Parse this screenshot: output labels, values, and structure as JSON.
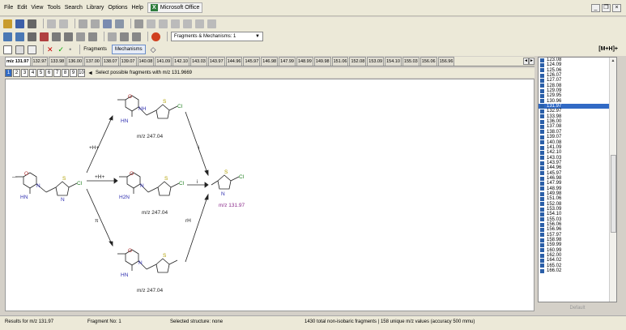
{
  "menu": {
    "items": [
      "File",
      "Edit",
      "View",
      "Tools",
      "Search",
      "Library",
      "Options",
      "Help"
    ],
    "office_label": "Microsoft Office"
  },
  "toolbar": {
    "combo_value": "Fragments & Mechanisms: 1"
  },
  "toolbar3": {
    "fragments_label": "Fragments",
    "mechanisms_label": "Mechanisms"
  },
  "mh_label": "[M+H]+",
  "tabs": [
    "m/z 131.97",
    "132.97",
    "133.98",
    "136.00",
    "137.00",
    "138.07",
    "139.07",
    "140.08",
    "141.09",
    "142.10",
    "143.03",
    "143.97",
    "144.96",
    "145.97",
    "146.98",
    "147.99",
    "148.99",
    "149.98",
    "151.06",
    "152.08",
    "153.09",
    "154.10",
    "155.03",
    "156.06",
    "156.96"
  ],
  "fragment_numbers": [
    "1",
    "2",
    "3",
    "4",
    "5",
    "6",
    "7",
    "8",
    "9",
    "10"
  ],
  "fragment_hint": "Select possible fragments with m/z 131.9669",
  "mechanism": {
    "top_label": "m/z 247.04",
    "middle_label": "m/z 247.04",
    "bottom_label": "m/z 247.04",
    "product_label": "m/z 131.97",
    "arrow_top": "+H+",
    "arrow_middle": "+H+",
    "arrow_bottom": "π",
    "arrow_right_top": "i",
    "arrow_right_middle": "i",
    "arrow_right_bottom": "rH",
    "cl": "Cl",
    "hn": "HN",
    "n": "N",
    "s": "S",
    "nh": "NH",
    "o": "O",
    "h2n": "H2N"
  },
  "mz_list": [
    "123.08",
    "124.09",
    "125.06",
    "126.07",
    "127.07",
    "128.08",
    "129.09",
    "129.95",
    "130.96",
    "131.97",
    "132.97",
    "133.98",
    "136.00",
    "137.08",
    "138.07",
    "139.07",
    "140.08",
    "141.09",
    "142.10",
    "143.03",
    "143.97",
    "144.96",
    "145.97",
    "146.98",
    "147.99",
    "148.99",
    "149.98",
    "151.06",
    "152.08",
    "153.09",
    "154.10",
    "155.03",
    "156.06",
    "156.96",
    "157.97",
    "158.98",
    "159.99",
    "160.99",
    "162.00",
    "164.02",
    "165.02",
    "166.02"
  ],
  "selected_mz": "131.97",
  "list_default": "Default",
  "status": {
    "results": "Results for m/z 131.97",
    "fragment_no": "Fragment No: 1",
    "selected_structure": "Selected structure: none",
    "summary": "1430 total non-isobaric fragments | 158 unique m/z values (accuracy 500 mmu)"
  }
}
